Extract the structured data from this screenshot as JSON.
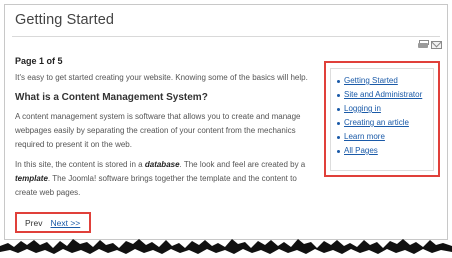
{
  "article": {
    "title": "Getting Started",
    "page_indicator": "Page 1 of 5",
    "intro": "It's easy to get started creating your website. Knowing some of the basics will help.",
    "heading": "What is a Content Management System?",
    "cms_paragraph": "A content management system is software that allows you to create and manage webpages easily by separating the creation of your content from the mechanics required to present it on the web.",
    "db_text_1": "In this site, the content is stored in a ",
    "db_term": "database",
    "db_text_2": ". The look and feel are created by a ",
    "template_term": "template",
    "db_text_3": ". The Joomla! software brings together the template and the content to create web pages."
  },
  "tools": {
    "print_icon": "print-icon",
    "email_icon": "email-icon"
  },
  "toc": {
    "items": [
      "Getting Started",
      "Site and Administrator",
      "Logging in",
      "Creating an article",
      "Learn more",
      "All Pages"
    ]
  },
  "pagination": {
    "prev_label": "Prev",
    "next_label": "Next >>"
  },
  "colors": {
    "highlight_border": "#e0403a",
    "link": "#1a5aa8"
  }
}
